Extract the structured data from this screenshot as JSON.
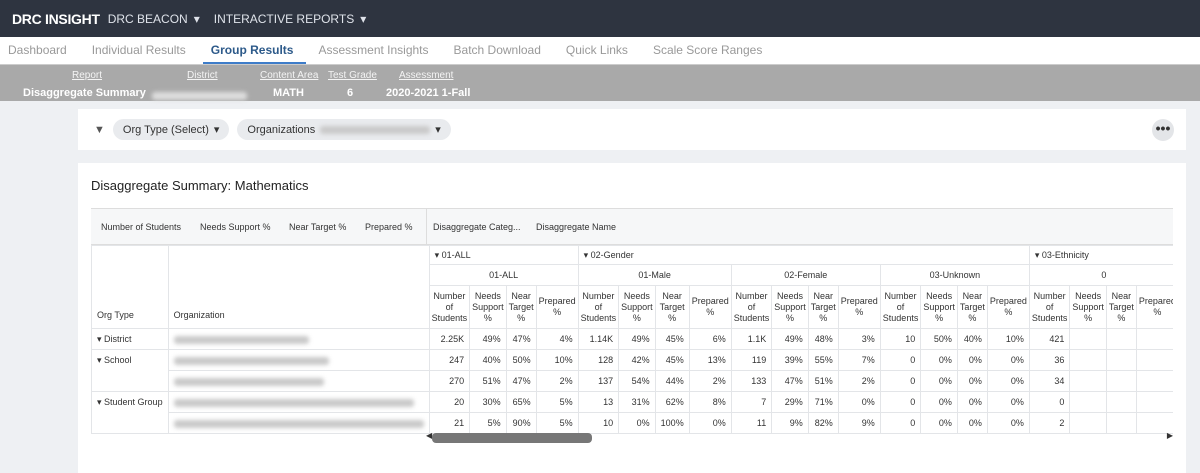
{
  "header": {
    "logo": "DRC INSIGHT",
    "menus": [
      "DRC BEACON",
      "INTERACTIVE REPORTS"
    ]
  },
  "nav": {
    "tabs": [
      "Dashboard",
      "Individual Results",
      "Group Results",
      "Assessment Insights",
      "Batch Download",
      "Quick Links",
      "Scale Score Ranges"
    ],
    "active": "Group Results"
  },
  "breadcrumb": {
    "labels": [
      "Report",
      "District",
      "Content Area",
      "Test Grade",
      "Assessment"
    ],
    "values": {
      "report": "Disaggregate Summary",
      "content_area": "MATH",
      "test_grade": "6",
      "assessment": "2020-2021 1-Fall"
    }
  },
  "filters": {
    "org_type": "Org Type (Select)",
    "organizations": "Organizations",
    "more": "•••"
  },
  "report": {
    "title": "Disaggregate Summary: Mathematics",
    "fields": [
      "Number of Students",
      "Needs Support %",
      "Near Target %",
      "Prepared %",
      "Disaggregate Categ...",
      "Disaggregate Name"
    ],
    "left_headers": [
      "Org Type",
      "Organization"
    ],
    "categories": [
      "01-ALL",
      "02-Gender",
      "03-Ethnicity"
    ],
    "subgroups": [
      "01-ALL",
      "01-Male",
      "02-Female",
      "03-Unknown",
      "0"
    ],
    "col_headers": [
      "Number of Students",
      "Needs Support %",
      "Near Target %",
      "Prepared %"
    ],
    "org_types": [
      "District",
      "School",
      "",
      "Student Group",
      ""
    ],
    "rows": [
      [
        "2.25K",
        "49%",
        "47%",
        "4%",
        "1.14K",
        "49%",
        "45%",
        "6%",
        "1.1K",
        "49%",
        "48%",
        "3%",
        "10",
        "50%",
        "40%",
        "10%",
        "421"
      ],
      [
        "247",
        "40%",
        "50%",
        "10%",
        "128",
        "42%",
        "45%",
        "13%",
        "119",
        "39%",
        "55%",
        "7%",
        "0",
        "0%",
        "0%",
        "0%",
        "36"
      ],
      [
        "270",
        "51%",
        "47%",
        "2%",
        "137",
        "54%",
        "44%",
        "2%",
        "133",
        "47%",
        "51%",
        "2%",
        "0",
        "0%",
        "0%",
        "0%",
        "34"
      ],
      [
        "20",
        "30%",
        "65%",
        "5%",
        "13",
        "31%",
        "62%",
        "8%",
        "7",
        "29%",
        "71%",
        "0%",
        "0",
        "0%",
        "0%",
        "0%",
        "0"
      ],
      [
        "21",
        "5%",
        "90%",
        "5%",
        "10",
        "0%",
        "100%",
        "0%",
        "11",
        "9%",
        "82%",
        "9%",
        "0",
        "0%",
        "0%",
        "0%",
        "2"
      ]
    ]
  }
}
